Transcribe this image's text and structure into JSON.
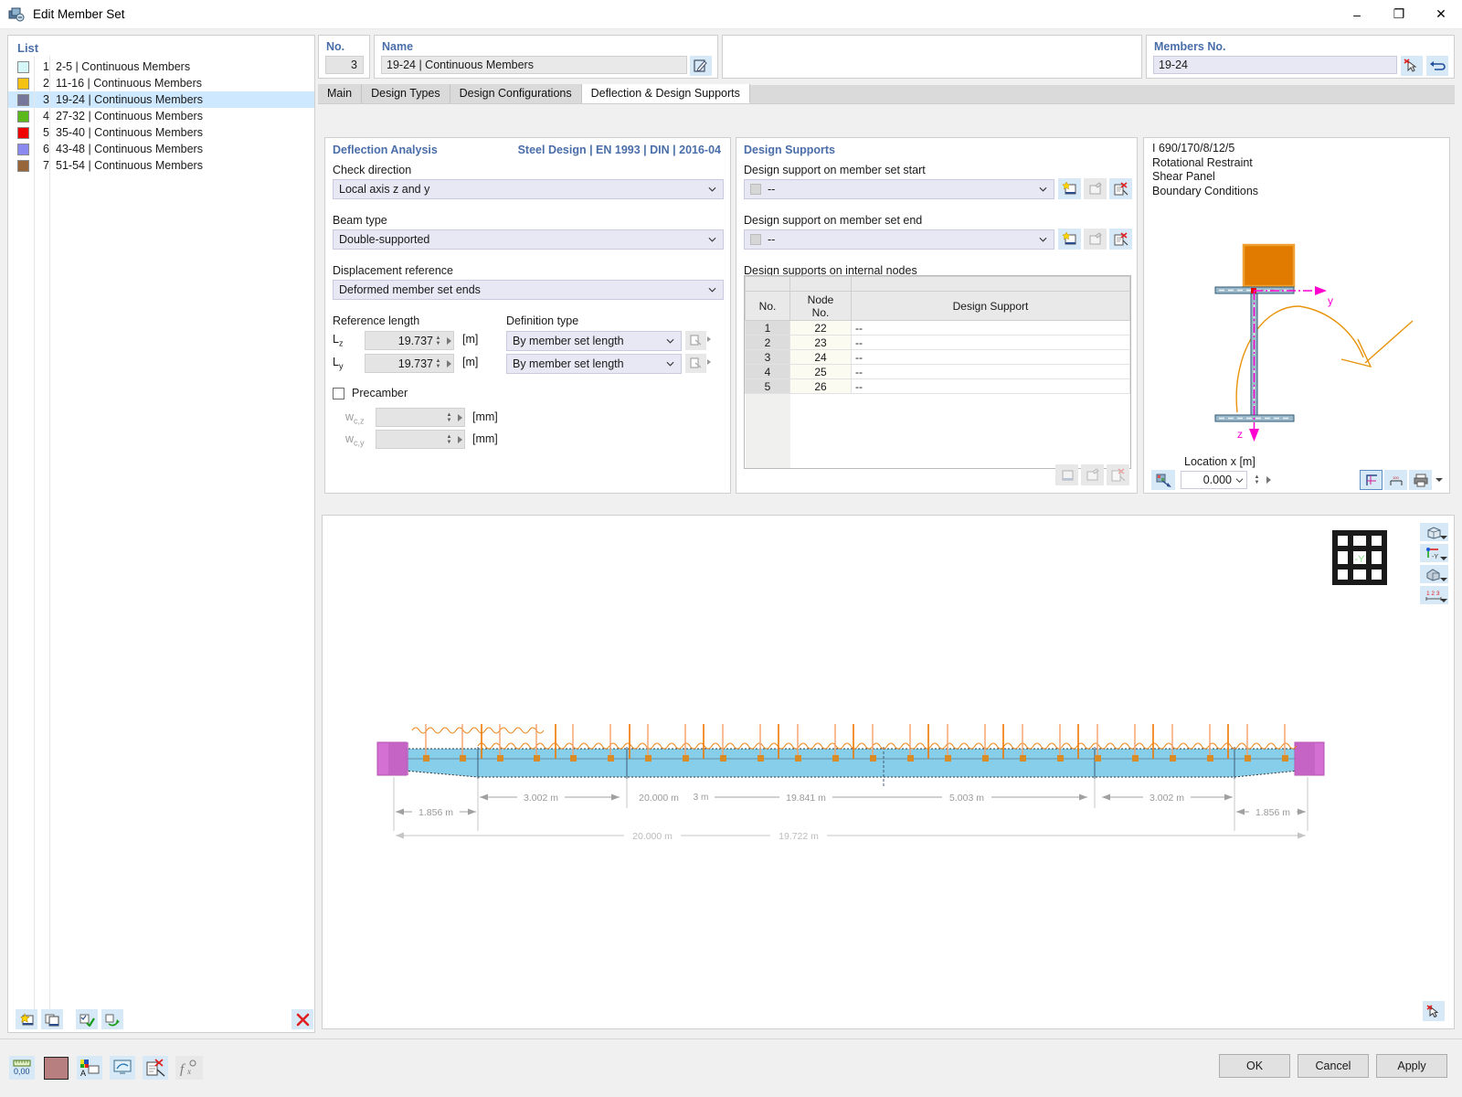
{
  "window": {
    "title": "Edit Member Set",
    "icon": "member-set-icon",
    "minimize": "–",
    "maximize": "❐",
    "close": "✕"
  },
  "list": {
    "header": "List",
    "items": [
      {
        "index": "1",
        "label": "2-5 | Continuous Members",
        "color": "#d5f7f7"
      },
      {
        "index": "2",
        "label": "11-16 | Continuous Members",
        "color": "#f5c211"
      },
      {
        "index": "3",
        "label": "19-24 | Continuous Members",
        "color": "#77779b"
      },
      {
        "index": "4",
        "label": "27-32 | Continuous Members",
        "color": "#5bb81b"
      },
      {
        "index": "5",
        "label": "35-40 | Continuous Members",
        "color": "#f00000"
      },
      {
        "index": "6",
        "label": "43-48 | Continuous Members",
        "color": "#8a8af0"
      },
      {
        "index": "7",
        "label": "51-54 | Continuous Members",
        "color": "#96653a"
      }
    ],
    "selected_index": 2
  },
  "header": {
    "no_label": "No.",
    "no_value": "3",
    "name_label": "Name",
    "name_value": "19-24 | Continuous Members",
    "members_label": "Members No.",
    "members_value": "19-24"
  },
  "tabs": [
    {
      "label": "Main",
      "active": false
    },
    {
      "label": "Design Types",
      "active": false
    },
    {
      "label": "Design Configurations",
      "active": false
    },
    {
      "label": "Deflection & Design Supports",
      "active": true
    }
  ],
  "deflection": {
    "group_title": "Deflection Analysis",
    "standard": "Steel Design | EN 1993 | DIN | 2016-04",
    "check_direction_label": "Check direction",
    "check_direction_value": "Local axis z and y",
    "beam_type_label": "Beam type",
    "beam_type_value": "Double-supported",
    "displacement_reference_label": "Displacement reference",
    "displacement_reference_value": "Deformed member set ends",
    "reference_length_label": "Reference length",
    "definition_type_label": "Definition type",
    "lz_symbol": "L",
    "lz_sub": "z",
    "lz_value": "19.737",
    "lz_unit": "[m]",
    "lz_deftype": "By member set length",
    "ly_symbol": "L",
    "ly_sub": "y",
    "ly_value": "19.737",
    "ly_unit": "[m]",
    "ly_deftype": "By member set length",
    "precamber_label": "Precamber",
    "precamber_checked": false,
    "wcz_symbol": "w",
    "wcz_sub": "c,z",
    "wcz_value": "",
    "wcz_unit": "[mm]",
    "wcy_symbol": "w",
    "wcy_sub": "c,y",
    "wcy_value": "",
    "wcy_unit": "[mm]"
  },
  "supports": {
    "group_title": "Design Supports",
    "start_label": "Design support on member set start",
    "start_value": "--",
    "end_label": "Design support on member set end",
    "end_value": "--",
    "internal_label": "Design supports on internal nodes",
    "columns": [
      "No.",
      "Node\nNo.",
      "Design Support"
    ],
    "col_no": "No.",
    "col_node_1": "Node",
    "col_node_2": "No.",
    "col_support": "Design Support",
    "rows": [
      {
        "no": "1",
        "node": "22",
        "support": "--"
      },
      {
        "no": "2",
        "node": "23",
        "support": "--"
      },
      {
        "no": "3",
        "node": "24",
        "support": "--"
      },
      {
        "no": "4",
        "node": "25",
        "support": "--"
      },
      {
        "no": "5",
        "node": "26",
        "support": "--"
      }
    ]
  },
  "preview": {
    "line1": "I 690/170/8/12/5",
    "line2": "Rotational Restraint",
    "line3": "Shear Panel",
    "line4": "Boundary Conditions",
    "axis_y": "y",
    "axis_z": "z",
    "location_label": "Location x [m]",
    "location_value": "0.000"
  },
  "viewport": {
    "dimensions_row1": [
      "1.856 m",
      "3.002 m",
      "20.000 m",
      "3 m",
      "19.841 m",
      "5.003 m",
      "3.002 m",
      "1.856 m"
    ],
    "dim_1856_a": "1.856 m",
    "dim_3002_a": "3.002 m",
    "dim_20000": "20.000 m",
    "dim_3m": "3 m",
    "dim_19841": "19.841 m",
    "dim_5003": "5.003 m",
    "dim_3002_b": "3.002 m",
    "dim_1856_b": "1.856 m",
    "dim_total_a": "20.000 m",
    "dim_total_b": "19.722 m"
  },
  "footer": {
    "ok": "OK",
    "cancel": "Cancel",
    "apply": "Apply"
  },
  "colors": {
    "accent_blue": "#4a6ea9",
    "selection": "#cde8ff",
    "combo_bg": "#e7e8f3",
    "beam_fill": "#87ceeb",
    "load_orange": "#f07800",
    "support_magenta": "#d46fd4",
    "axis_magenta": "#ff00d0"
  }
}
